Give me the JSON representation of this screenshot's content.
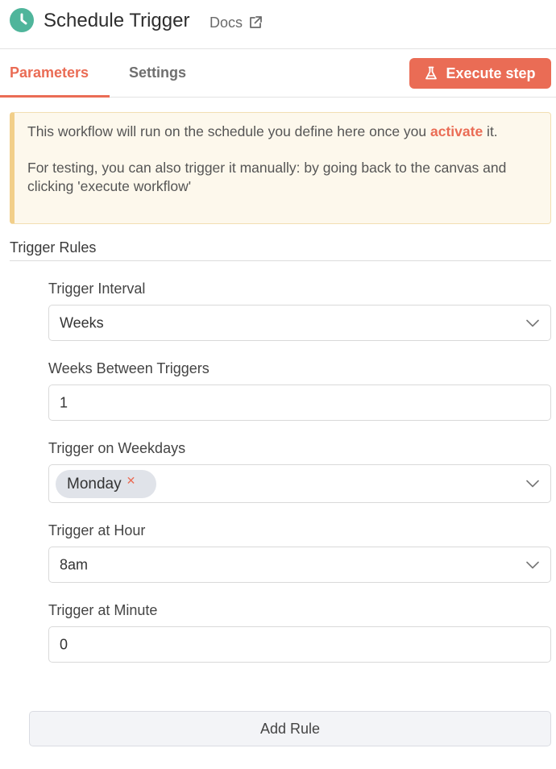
{
  "header": {
    "title": "Schedule Trigger",
    "docs_label": "Docs",
    "node_icon": "clock-icon",
    "docs_icon": "external-link-icon"
  },
  "tabs": [
    {
      "label": "Parameters",
      "active": true
    },
    {
      "label": "Settings",
      "active": false
    }
  ],
  "execute_button": {
    "label": "Execute step",
    "icon": "flask-icon"
  },
  "notice": {
    "line1_before": "This workflow will run on the schedule you define here once you ",
    "line1_link": "activate",
    "line1_after": " it.",
    "line2": "For testing, you can also trigger it manually: by going back to the canvas and clicking 'execute workflow'"
  },
  "trigger_rules": {
    "title": "Trigger Rules",
    "fields": {
      "interval": {
        "label": "Trigger Interval",
        "value": "Weeks"
      },
      "weeks_between": {
        "label": "Weeks Between Triggers",
        "value": "1"
      },
      "weekdays": {
        "label": "Trigger on Weekdays",
        "selected": [
          "Monday"
        ]
      },
      "hour": {
        "label": "Trigger at Hour",
        "value": "8am"
      },
      "minute": {
        "label": "Trigger at Minute",
        "value": "0"
      }
    },
    "add_rule_label": "Add Rule"
  },
  "colors": {
    "accent": "#ea6c55",
    "node_icon_bg": "#4fb59b",
    "notice_bg": "#fdf8ec",
    "notice_border": "#f2cf8a",
    "tag_bg": "#e0e3e9"
  }
}
